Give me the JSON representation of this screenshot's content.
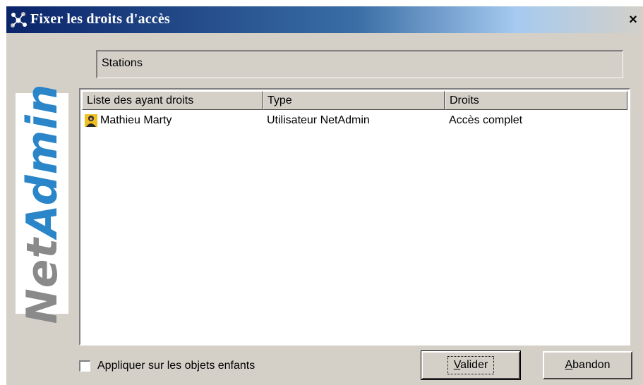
{
  "window": {
    "title": "Fixer les droits d'accès",
    "close_glyph": "×"
  },
  "logo": {
    "part1": "Net",
    "part2": "Admin",
    "colors": {
      "net": "#8a8a8a",
      "admin": "#2a86c8"
    }
  },
  "path_field": {
    "value": "Stations"
  },
  "list": {
    "columns": [
      "Liste des ayant droits",
      "Type",
      "Droits"
    ],
    "rows": [
      {
        "name": "Mathieu Marty",
        "type": "Utilisateur NetAdmin",
        "rights": "Accès complet",
        "icon": "user-icon"
      }
    ]
  },
  "options": {
    "apply_children_label": "Appliquer sur les objets enfants",
    "apply_children_checked": false
  },
  "buttons": {
    "validate": {
      "underline": "V",
      "rest": "alider"
    },
    "cancel": {
      "underline": "A",
      "rest": "bandon"
    }
  },
  "colors": {
    "titlebar_start": "#0a246a",
    "face": "#d4d0c8"
  }
}
